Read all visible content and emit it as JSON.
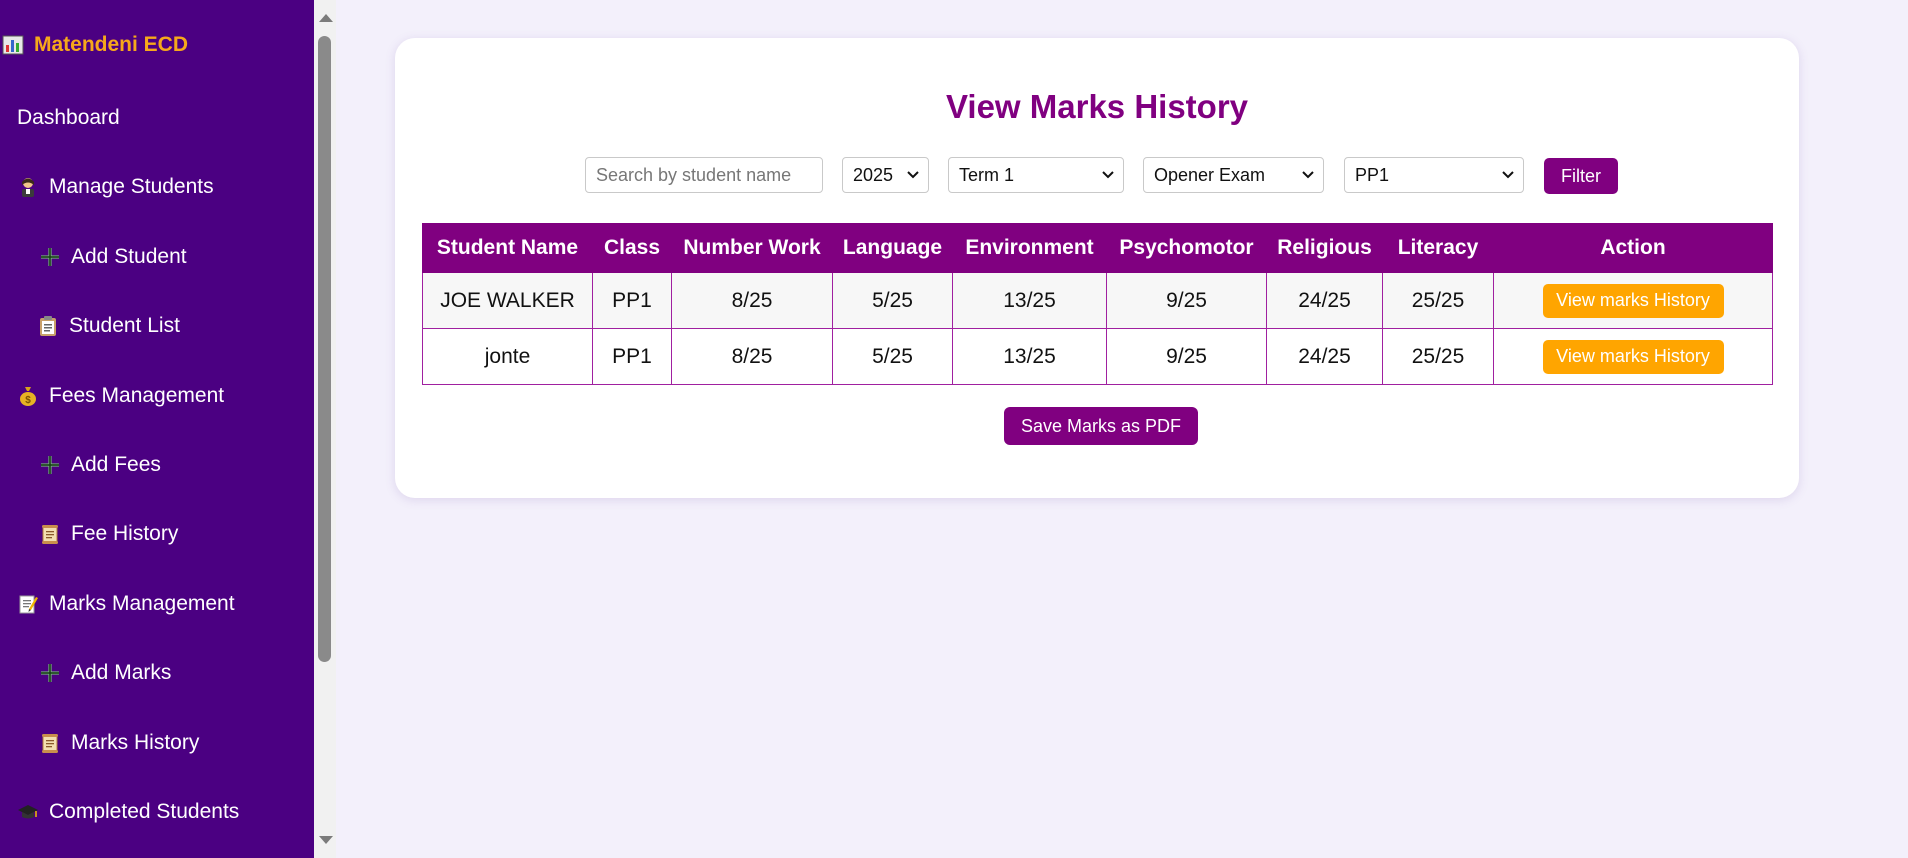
{
  "sidebar": {
    "brand": "Matendeni ECD",
    "brand_icon": "bar-chart-icon",
    "items": [
      {
        "label": "Dashboard",
        "icon": ""
      },
      {
        "label": "Manage Students",
        "icon": "student-icon"
      },
      {
        "label": "Add Student",
        "icon": "plus-icon"
      },
      {
        "label": "Student List",
        "icon": "clipboard-icon"
      },
      {
        "label": "Fees Management",
        "icon": "money-bag-icon"
      },
      {
        "label": "Add Fees",
        "icon": "plus-icon"
      },
      {
        "label": "Fee History",
        "icon": "scroll-icon"
      },
      {
        "label": "Marks Management",
        "icon": "memo-icon"
      },
      {
        "label": "Add Marks",
        "icon": "plus-icon"
      },
      {
        "label": "Marks History",
        "icon": "scroll-icon"
      },
      {
        "label": "Completed Students",
        "icon": "graduation-cap-icon"
      }
    ]
  },
  "main": {
    "title": "View Marks History",
    "filters": {
      "search_placeholder": "Search by student name",
      "year": "2025",
      "term": "Term 1",
      "exam": "Opener Exam",
      "class": "PP1",
      "filter_label": "Filter"
    },
    "table": {
      "headers": [
        "Student Name",
        "Class",
        "Number Work",
        "Language",
        "Environment",
        "Psychomotor",
        "Religious",
        "Literacy",
        "Action"
      ],
      "rows": [
        [
          "JOE WALKER",
          "PP1",
          "8/25",
          "5/25",
          "13/25",
          "9/25",
          "24/25",
          "25/25",
          "View marks History"
        ],
        [
          "jonte",
          "PP1",
          "8/25",
          "5/25",
          "13/25",
          "9/25",
          "24/25",
          "25/25",
          "View marks History"
        ]
      ]
    },
    "pdf_label": "Save Marks as PDF"
  },
  "colors": {
    "sidebar_bg": "#4b0082",
    "brand": "#f6a81b",
    "accent": "#800080",
    "action": "#ffa500",
    "page_bg": "#f3f0fb"
  }
}
